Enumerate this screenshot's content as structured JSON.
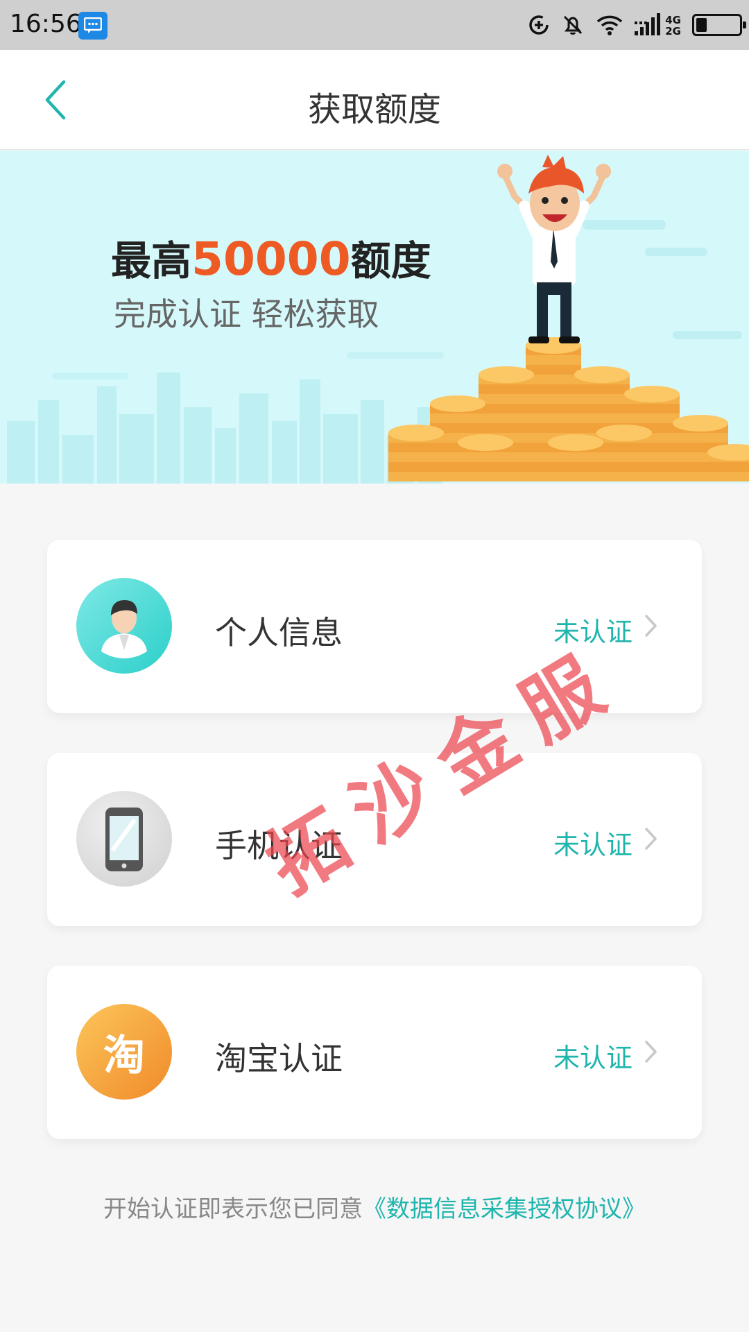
{
  "status_bar": {
    "time": "16:56",
    "network_labels": [
      "4G",
      "2G"
    ],
    "battery_level": 0.25,
    "icons": [
      "message-notification-icon",
      "data-saver-icon",
      "bell-off-icon",
      "wifi-icon",
      "signal-icon",
      "battery-icon"
    ]
  },
  "header": {
    "title": "获取额度",
    "back_icon": "chevron-left-icon",
    "accent_color": "#1fb5ad"
  },
  "banner": {
    "prefix": "最高",
    "amount": "50000",
    "suffix": "额度",
    "subtitle": "完成认证   轻松获取",
    "amount_color": "#ee5a24",
    "background_color": "#d5f8fa"
  },
  "cards": [
    {
      "title": "个人信息",
      "status": "未认证",
      "icon": "person-avatar-icon"
    },
    {
      "title": "手机认证",
      "status": "未认证",
      "icon": "mobile-phone-icon"
    },
    {
      "title": "淘宝认证",
      "status": "未认证",
      "icon": "taobao-icon",
      "icon_text": "淘"
    }
  ],
  "agreement": {
    "text": "开始认证即表示您已同意",
    "link": "《数据信息采集授权协议》"
  },
  "watermark": "拓沙金服"
}
